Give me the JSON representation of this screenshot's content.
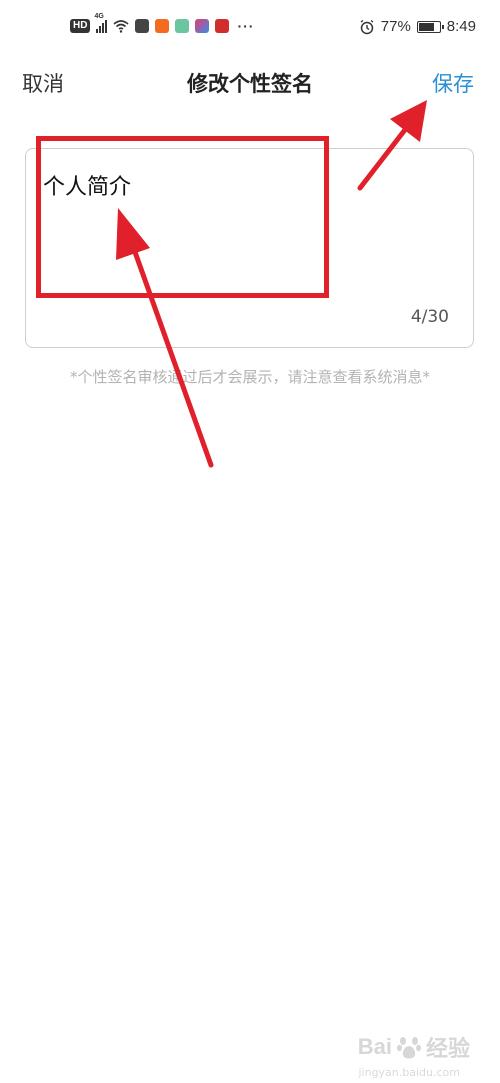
{
  "status_bar": {
    "hd": "HD",
    "network": "4G",
    "battery": "77%",
    "battery_level": 0.77,
    "time": "8:49",
    "more": "···"
  },
  "header": {
    "cancel_label": "取消",
    "title": "修改个性签名",
    "save_label": "保存"
  },
  "editor": {
    "value": "个人简介",
    "char_count": "4/30"
  },
  "hint": "*个性签名审核通过后才会展示，请注意查看系统消息*",
  "watermark": {
    "brand": "Bai",
    "brand_suffix": "经验",
    "url": "jingyan.baidu.com"
  },
  "colors": {
    "accent": "#2b8fd6",
    "annotation": "#e0202a"
  }
}
